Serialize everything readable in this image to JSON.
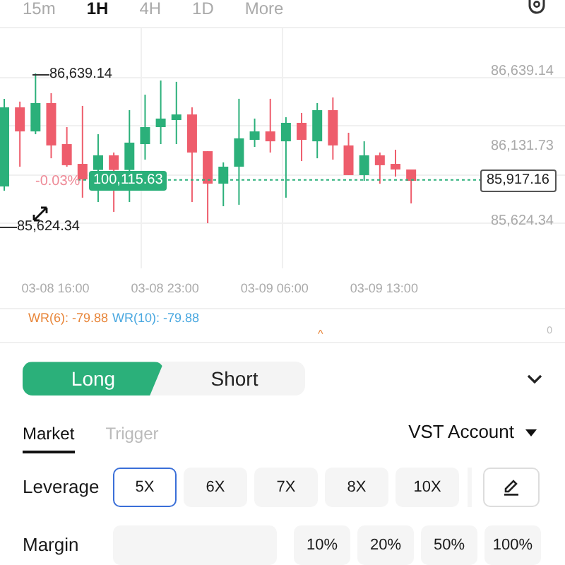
{
  "timeframes": [
    {
      "label": "15m",
      "selected": false
    },
    {
      "label": "1H",
      "selected": true
    },
    {
      "label": "4H",
      "selected": false
    },
    {
      "label": "1D",
      "selected": false
    },
    {
      "label": "More",
      "selected": false
    }
  ],
  "chart": {
    "high_label": "86,639.14",
    "low_label": "85,624.34",
    "change": "-0.03%",
    "mark_price": "100,115.63",
    "last_price": "85,917.16",
    "chart_data": {
      "type": "candlestick",
      "categories": [
        null,
        null,
        null,
        "03-08 16:00",
        null,
        null,
        null,
        null,
        null,
        null,
        "03-08 23:00",
        null,
        null,
        null,
        null,
        null,
        null,
        "03-09 06:00",
        null,
        null,
        null,
        null,
        null,
        null,
        "03-09 13:00",
        null,
        null
      ],
      "ohlc": [
        [
          85873,
          86467,
          85844,
          86409
        ],
        [
          86409,
          86448,
          86007,
          86246
        ],
        [
          86246,
          86639,
          86227,
          86438
        ],
        [
          86438,
          86505,
          86064,
          86151
        ],
        [
          86160,
          86275,
          86007,
          86017
        ],
        [
          86026,
          86419,
          85797,
          85921
        ],
        [
          85985,
          86227,
          85768,
          86084
        ],
        [
          86084,
          86103,
          85701,
          85985
        ],
        [
          85985,
          86390,
          85768,
          86170
        ],
        [
          86160,
          86495,
          86055,
          86275
        ],
        [
          86275,
          86591,
          86160,
          86333
        ],
        [
          86323,
          86582,
          86160,
          86361
        ],
        [
          86361,
          86409,
          85768,
          86103
        ],
        [
          86112,
          86112,
          85624,
          85892
        ],
        [
          85892,
          86036,
          85739,
          86007
        ],
        [
          86007,
          86467,
          85749,
          86199
        ],
        [
          86189,
          86333,
          86141,
          86246
        ],
        [
          86246,
          86467,
          86103,
          86179
        ],
        [
          86179,
          86342,
          85797,
          86304
        ],
        [
          86304,
          86371,
          86045,
          86189
        ],
        [
          86179,
          86438,
          86064,
          86390
        ],
        [
          86390,
          86476,
          86055,
          86151
        ],
        [
          86151,
          86237,
          85950,
          85950
        ],
        [
          85950,
          86179,
          85911,
          86084
        ],
        [
          86084,
          86103,
          85892,
          86017
        ],
        [
          86026,
          86122,
          85940,
          85988
        ],
        [
          85988,
          85988,
          85758,
          85911
        ]
      ],
      "ylim": [
        85318,
        86945
      ],
      "ref_lines": [
        {
          "axis": "y",
          "value": 85917.16
        }
      ],
      "yticks": [
        {
          "value": 86639.14,
          "label": "86,639.14"
        },
        {
          "value": 86131.73,
          "label": "86,131.73"
        },
        {
          "value": 85624.34,
          "label": "85,624.34"
        }
      ]
    }
  },
  "indicators": [
    {
      "label": "WR(6): -79.88",
      "color": "#e8863a"
    },
    {
      "label": "WR(10): -79.88",
      "color": "#4aa8e0"
    }
  ],
  "sub_chart": {
    "marker": "^",
    "axis_label": "0"
  },
  "sides": [
    {
      "label": "Long",
      "selected": true
    },
    {
      "label": "Short",
      "selected": false
    }
  ],
  "order_types": [
    {
      "label": "Market",
      "selected": true
    },
    {
      "label": "Trigger",
      "selected": false
    }
  ],
  "account": "VST Account",
  "leverage": {
    "label": "Leverage",
    "options": [
      {
        "label": "5X",
        "selected": true
      },
      {
        "label": "6X",
        "selected": false
      },
      {
        "label": "7X",
        "selected": false
      },
      {
        "label": "8X",
        "selected": false
      },
      {
        "label": "10X",
        "selected": false
      }
    ]
  },
  "margin": {
    "label": "Margin",
    "options": [
      "10%",
      "20%",
      "50%",
      "100%"
    ]
  }
}
